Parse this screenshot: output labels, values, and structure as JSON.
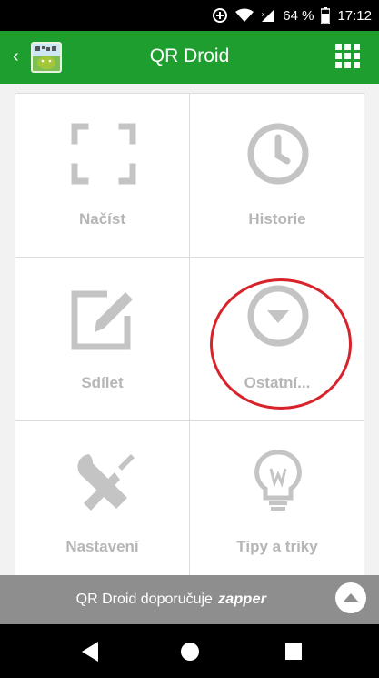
{
  "status_bar": {
    "battery_percent": "64 %",
    "time": "17:12",
    "icons": [
      "data-saver-icon",
      "wifi-icon",
      "signal-icon",
      "battery-icon"
    ]
  },
  "app_bar": {
    "back_glyph": "‹",
    "title": "QR Droid",
    "menu_icon": "grid-menu-icon"
  },
  "grid": {
    "items": [
      {
        "label": "Načíst",
        "icon": "scan-frame-icon"
      },
      {
        "label": "Historie",
        "icon": "clock-icon"
      },
      {
        "label": "Sdílet",
        "icon": "edit-icon"
      },
      {
        "label": "Ostatní...",
        "icon": "dropdown-circle-icon"
      },
      {
        "label": "Nastavení",
        "icon": "tools-icon"
      },
      {
        "label": "Tipy a triky",
        "icon": "lightbulb-icon"
      }
    ]
  },
  "banner": {
    "text": "QR Droid doporučuje",
    "brand": "zapper"
  },
  "colors": {
    "app_bar": "#1e9e2f",
    "icon_gray": "#c4c4c4",
    "label_gray": "#b6b6b6",
    "highlight": "#d8232a",
    "banner": "#8e8e8e"
  }
}
